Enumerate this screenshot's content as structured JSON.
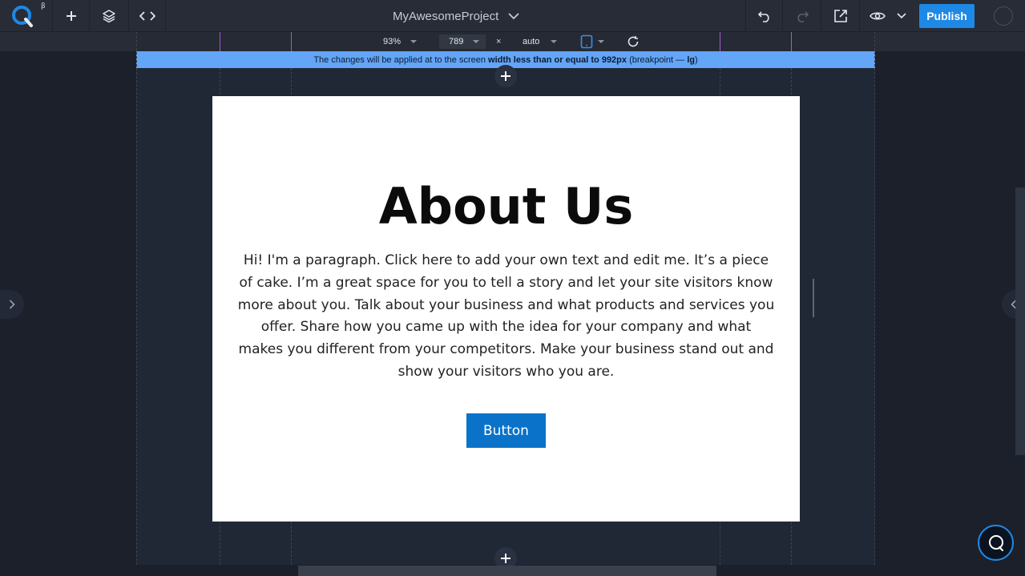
{
  "app": {
    "logo_superscript": "β",
    "project_name": "MyAwesomeProject",
    "publish_label": "Publish"
  },
  "toolbar": {
    "icons": [
      "plus-icon",
      "layers-icon",
      "code-icon",
      "undo-icon",
      "redo-icon",
      "external-link-icon",
      "eye-icon",
      "chevron-down-icon"
    ]
  },
  "viewport": {
    "zoom": "93%",
    "width": "789",
    "times": "×",
    "height": "auto"
  },
  "banner": {
    "prefix": "The changes will be applied at to the screen ",
    "strong": "width less than or equal to 992px",
    "middle": " (breakpoint — ",
    "bp": "lg",
    "suffix": ")"
  },
  "card": {
    "title": "About Us",
    "paragraph": "Hi! I'm a paragraph. Click here to add your own text and edit me. It’s a piece of cake. I’m a great space for you to tell a story and let your site visitors know more about you. Talk about your business and what products and services you offer. Share how you came up with the idea for your company and what makes you different from your competitors. Make your business stand out and show your visitors who you are.",
    "button_label": "Button"
  },
  "colors": {
    "accent": "#1e88e5",
    "banner": "#63a5f7",
    "button": "#0a72c9",
    "guide": "#a35ad0"
  }
}
